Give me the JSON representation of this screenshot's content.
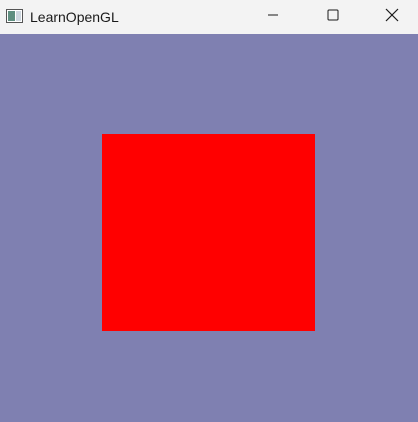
{
  "window": {
    "title": "LearnOpenGL",
    "icon": "opengl-app-icon"
  },
  "controls": {
    "minimize_icon": "minimize-icon",
    "maximize_icon": "maximize-icon",
    "close_icon": "close-icon"
  },
  "scene": {
    "clear_color": "#7f80b1",
    "quad_color": "#ff0000"
  }
}
